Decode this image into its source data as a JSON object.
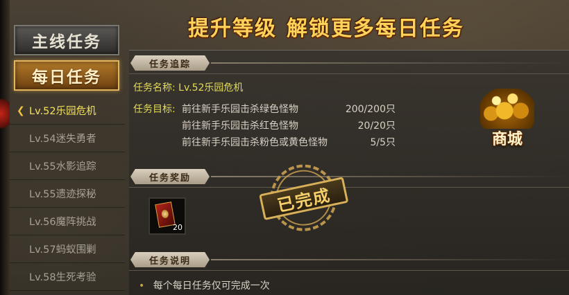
{
  "title": {
    "part1": "提升等级",
    "part2": "解锁更多每日任务"
  },
  "sidebar": {
    "tab_main": "主线任务",
    "tab_daily": "每日任务",
    "quests": [
      {
        "label": "Lv.52乐园危机",
        "active": true
      },
      {
        "label": "Lv.54迷失勇者",
        "active": false
      },
      {
        "label": "Lv.55水影追踪",
        "active": false
      },
      {
        "label": "Lv.55遗迹探秘",
        "active": false
      },
      {
        "label": "Lv.56魔阵挑战",
        "active": false
      },
      {
        "label": "Lv.57蚂蚁围剿",
        "active": false
      },
      {
        "label": "Lv.58生死考验",
        "active": false
      }
    ]
  },
  "tracking": {
    "header": "任务追踪",
    "name_label": "任务名称:",
    "name_value": "Lv.52乐园危机",
    "goal_label": "任务目标:",
    "goals": [
      {
        "text": "前往新手乐园击杀绿色怪物",
        "count": "200/200只"
      },
      {
        "text": "前往新手乐园击杀红色怪物",
        "count": "20/20只"
      },
      {
        "text": "前往新手乐园击杀粉色或黄色怪物",
        "count": "5/5只"
      }
    ]
  },
  "reward": {
    "header": "任务奖励",
    "item_count": "20",
    "item_icon": "red-book-icon",
    "stamp": "已完成"
  },
  "shop": {
    "label": "商城",
    "icon": "gold-pile-icon"
  },
  "description": {
    "header": "任务说明",
    "bullet": "每个每日任务仅可完成一次"
  }
}
